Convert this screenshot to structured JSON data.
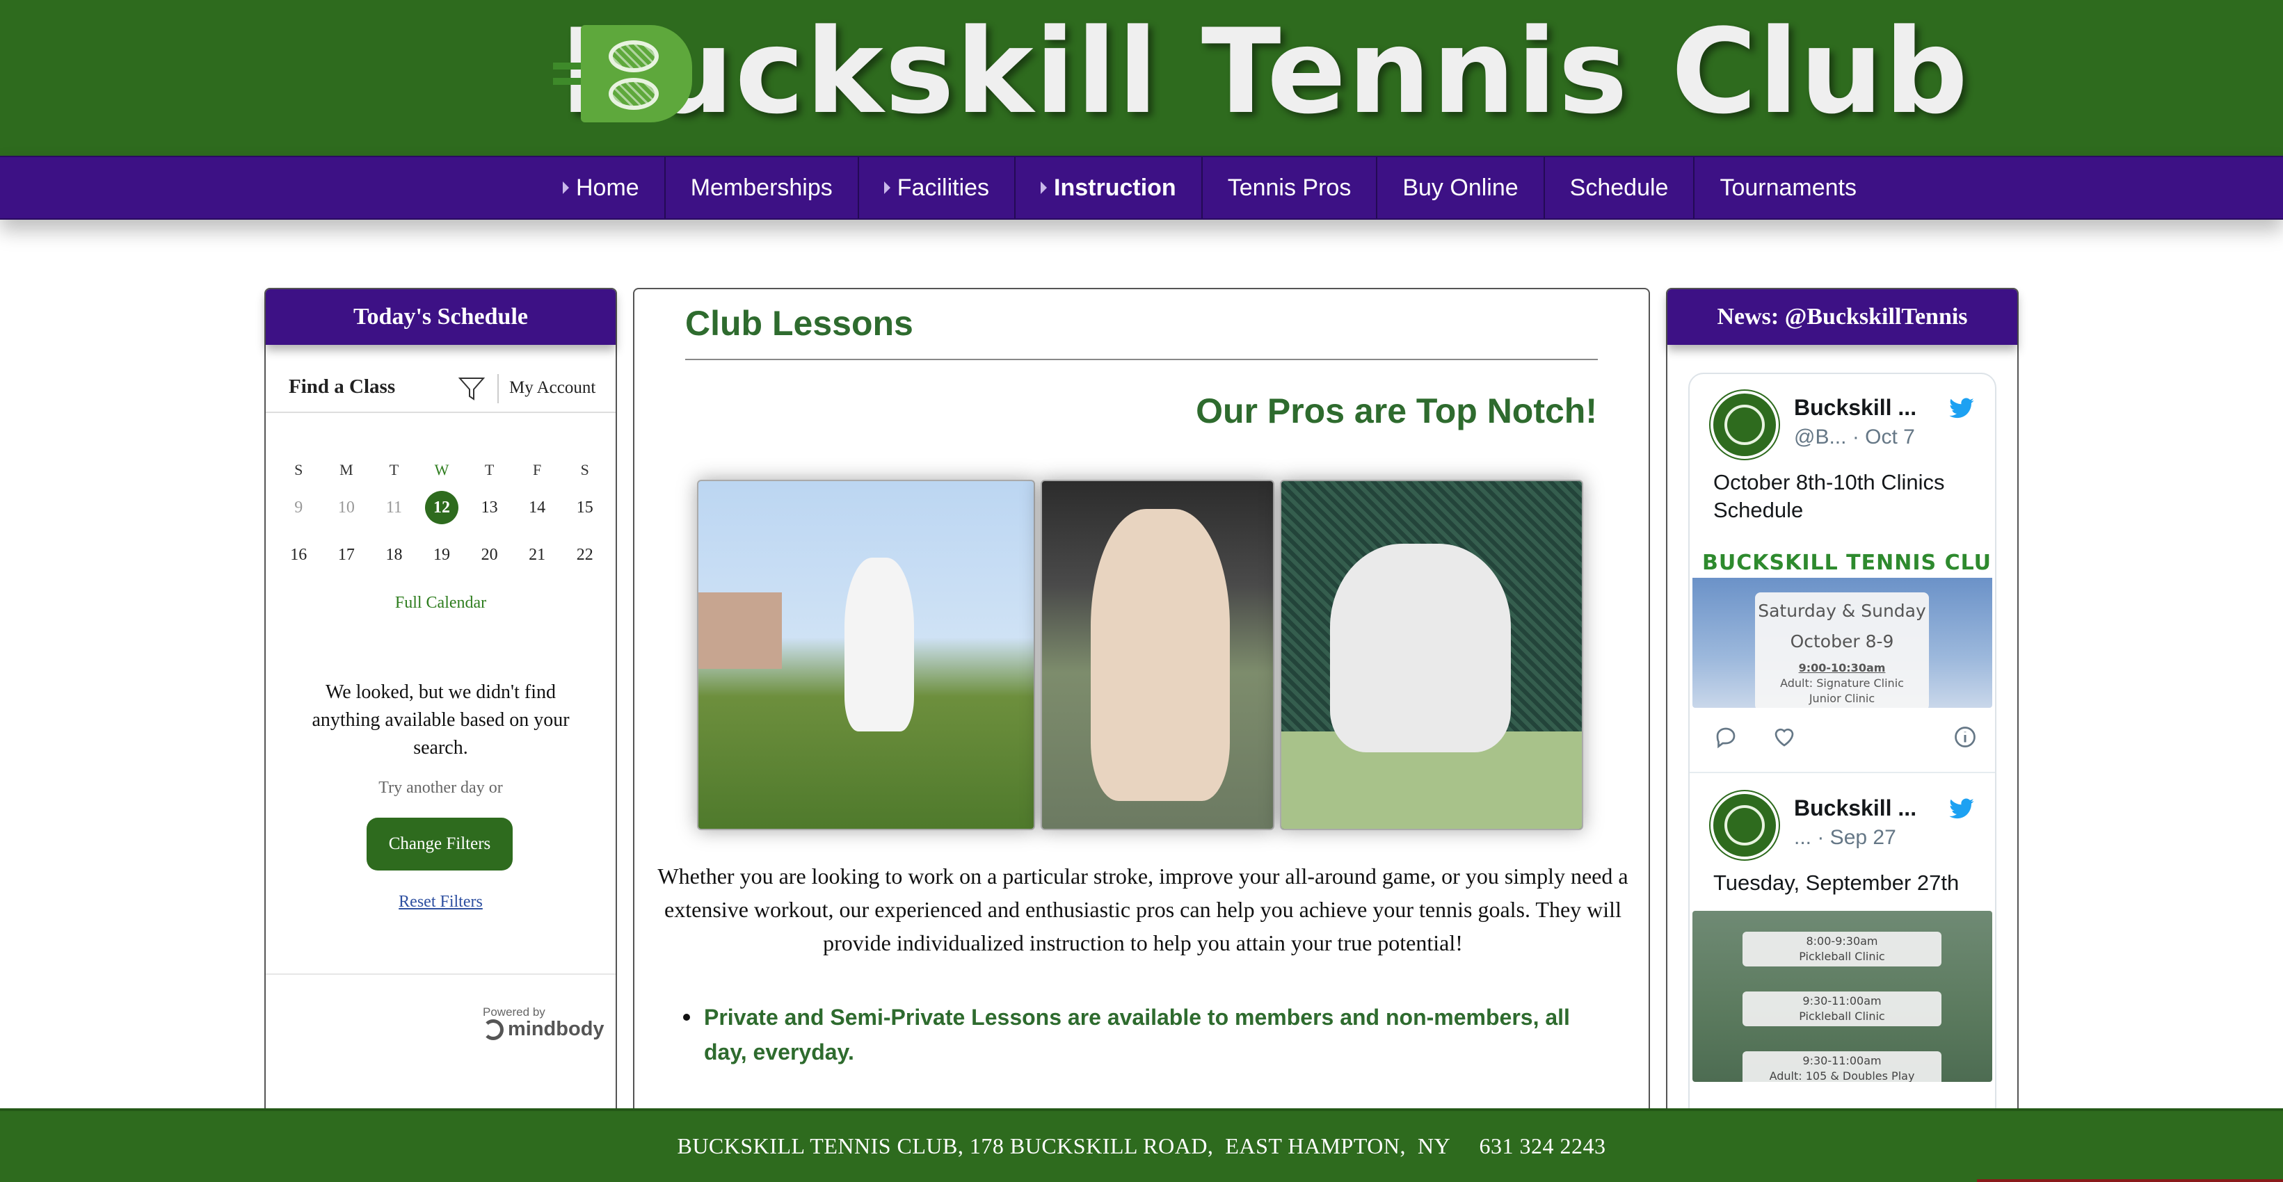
{
  "header": {
    "logo_text": "Buckskill Tennis Club"
  },
  "nav": {
    "items": [
      {
        "label": "Home",
        "has_caret": true
      },
      {
        "label": "Memberships",
        "has_caret": false
      },
      {
        "label": "Facilities",
        "has_caret": true
      },
      {
        "label": "Instruction",
        "has_caret": true,
        "active": true
      },
      {
        "label": "Tennis Pros",
        "has_caret": false
      },
      {
        "label": "Buy Online",
        "has_caret": false
      },
      {
        "label": "Schedule",
        "has_caret": false
      },
      {
        "label": "Tournaments",
        "has_caret": false
      }
    ]
  },
  "left_panel": {
    "title": "Today's Schedule",
    "find_a_class": "Find a Class",
    "my_account": "My Account",
    "calendar": {
      "days_of_week": [
        "S",
        "M",
        "T",
        "W",
        "T",
        "F",
        "S"
      ],
      "today_dow_index": 3,
      "weeks": [
        [
          "9",
          "10",
          "11",
          "12",
          "13",
          "14",
          "15"
        ],
        [
          "16",
          "17",
          "18",
          "19",
          "20",
          "21",
          "22"
        ]
      ],
      "today": "12",
      "full_calendar": "Full Calendar"
    },
    "no_results": "We looked, but we didn't find anything available based on your search.",
    "try_another": "Try another day or",
    "change_filters": "Change Filters",
    "reset_filters": "Reset Filters",
    "powered_by": "Powered by",
    "powered_brand": "mindbody"
  },
  "main": {
    "title": "Club Lessons",
    "subtitle": "Our Pros are Top Notch!",
    "body": "Whether you are looking to work on a particular stroke, improve your all-around game, or you simply need a extensive workout, our experienced and enthusiastic pros can help you achieve your tennis goals. They will provide individualized instruction to help you attain your true potential!",
    "bullets": [
      "Private and Semi-Private Lessons are available to members and non-members, all day, everyday."
    ]
  },
  "right_panel": {
    "title": "News: @BuckskillTennis",
    "tweets": [
      {
        "name": "Buckskill ...",
        "handle": "@B...",
        "date": "· Oct 7",
        "text": "October 8th-10th Clinics Schedule",
        "media_logo": "BUCKSKILL TENNIS CLUB",
        "media_card": {
          "line1": "Saturday & Sunday",
          "line2": "October 8-9",
          "time": "9:00-10:30am",
          "item1": "Adult: Signature Clinic",
          "item2": "Junior Clinic"
        }
      },
      {
        "name": "Buckskill ...",
        "handle": "...",
        "date": "· Sep 27",
        "text": "Tuesday, September 27th",
        "media_pills": [
          {
            "time": "8:00-9:30am",
            "label": "Pickleball Clinic"
          },
          {
            "time": "9:30-11:00am",
            "label": "Pickleball Clinic"
          },
          {
            "time": "9:30-11:00am",
            "label": "Adult: 105 & Doubles Play"
          }
        ]
      }
    ]
  },
  "footer": {
    "text": "BUCKSKILL TENNIS CLUB, 178 BUCKSKILL ROAD,  EAST HAMPTON,  NY     631 324 2243"
  },
  "colors": {
    "brand_green": "#2e6b1e",
    "nav_purple": "#3d1185",
    "heading_green": "#2e6b2e",
    "twitter_blue": "#1da1f2"
  }
}
